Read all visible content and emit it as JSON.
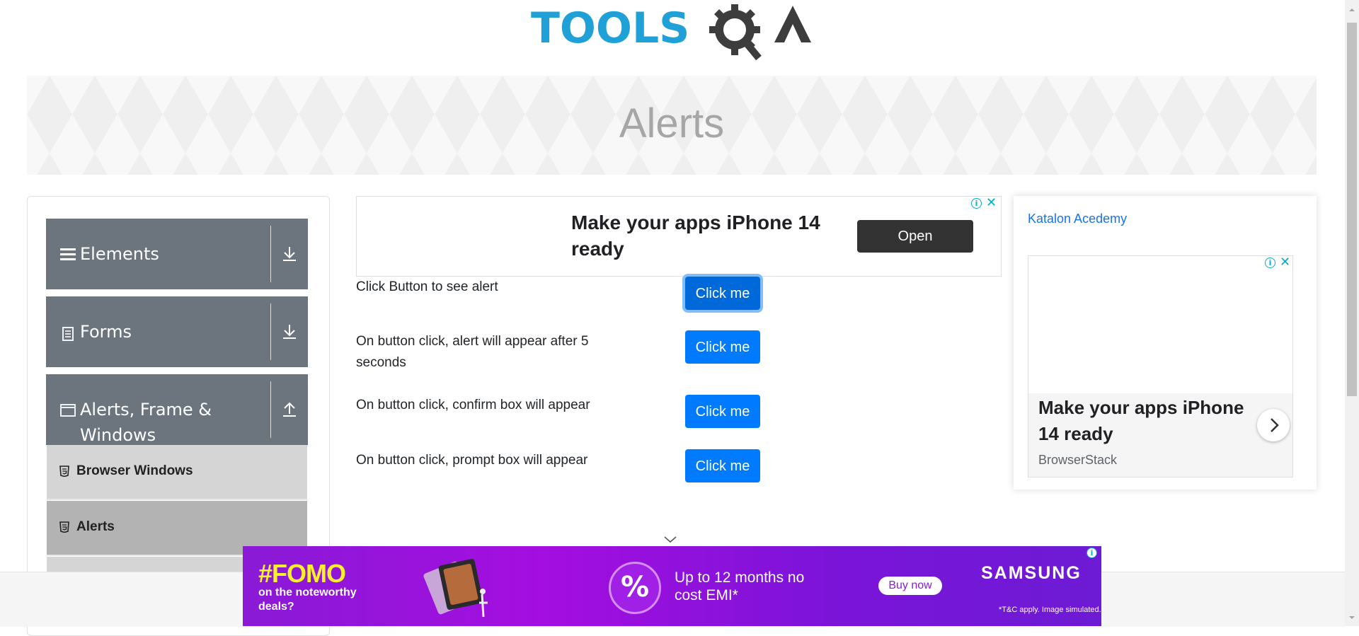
{
  "header": {
    "logo_text_a": "TOOLS",
    "logo_text_b": "QA"
  },
  "banner": {
    "title": "Alerts"
  },
  "sidebar": {
    "groups": [
      {
        "label": "Elements",
        "icon": "hamburger-icon",
        "arrow": "download-icon"
      },
      {
        "label": "Forms",
        "icon": "document-icon",
        "arrow": "download-icon"
      },
      {
        "label": "Alerts, Frame & Windows",
        "icon": "window-icon",
        "arrow": "upload-icon"
      }
    ],
    "items": [
      {
        "label": "Browser Windows",
        "icon": "html5-icon",
        "active": false
      },
      {
        "label": "Alerts",
        "icon": "html5-icon",
        "active": true
      }
    ]
  },
  "ad_top": {
    "headline": "Make your apps iPhone 14 ready",
    "button": "Open"
  },
  "alerts": {
    "rows": [
      {
        "text": "Click Button to see alert",
        "button": "Click me"
      },
      {
        "text": "On button click, alert will appear after 5 seconds",
        "button": "Click me"
      },
      {
        "text": "On button click, confirm box will appear",
        "button": "Click me"
      },
      {
        "text": "On button click, prompt box will appear",
        "button": "Click me"
      }
    ]
  },
  "right_column": {
    "image_alt": "Katalon Acedemy",
    "ad": {
      "headline": "Make your apps iPhone 14 ready",
      "source": "BrowserStack"
    }
  },
  "bottom_ad": {
    "headline": "#FOMO",
    "subtext": "on the noteworthy deals?",
    "percent": "%",
    "offer": "Up to 12 months no cost EMI*",
    "button": "Buy now",
    "brand": "SAMSUNG",
    "disclaimer": "*T&C apply. Image simulated."
  },
  "colors": {
    "primary": "#007bff",
    "sidebar": "#6c757d",
    "logo_blue": "#1fa0d7",
    "ad_purple": "#8a1ad6"
  }
}
